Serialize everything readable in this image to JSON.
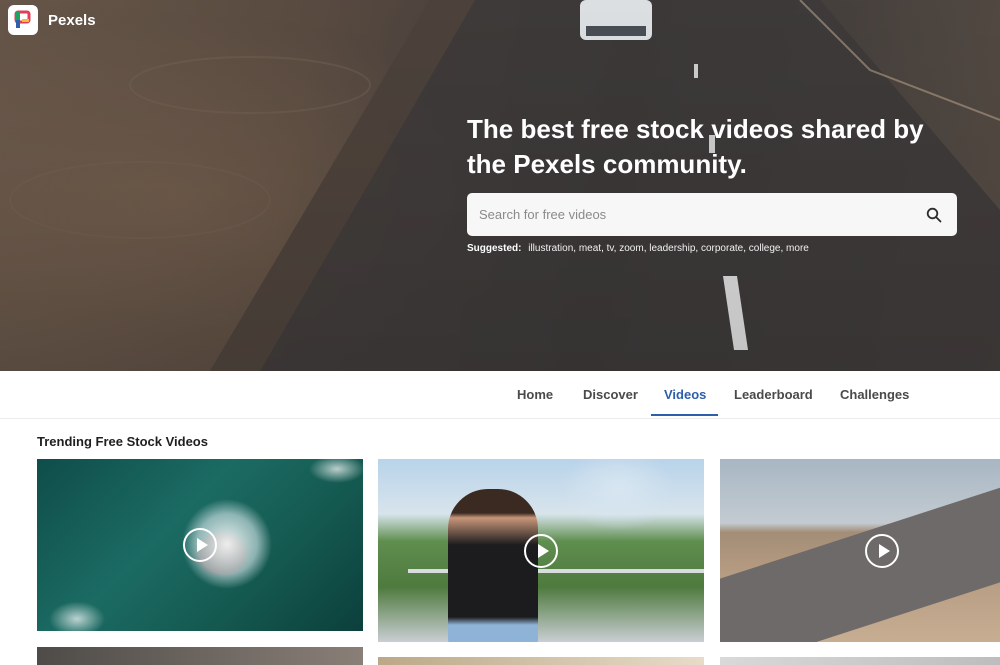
{
  "brand": {
    "name": "Pexels"
  },
  "hero": {
    "headline": "The best free stock videos shared by the Pexels community.",
    "search": {
      "placeholder": "Search for free videos",
      "value": ""
    },
    "suggested_label": "Suggested:",
    "suggested_tags": [
      "illustration",
      "meat",
      "tv",
      "zoom",
      "leadership",
      "corporate",
      "college",
      "more"
    ]
  },
  "nav": {
    "items": [
      {
        "label": "Home"
      },
      {
        "label": "Discover"
      },
      {
        "label": "Videos",
        "active": true
      },
      {
        "label": "Leaderboard"
      },
      {
        "label": "Challenges"
      }
    ]
  },
  "main": {
    "section_title": "Trending Free Stock Videos"
  },
  "colors": {
    "accent": "#2d5fab"
  },
  "icons": [
    "pexels-logo-icon",
    "search-icon",
    "play-icon"
  ]
}
